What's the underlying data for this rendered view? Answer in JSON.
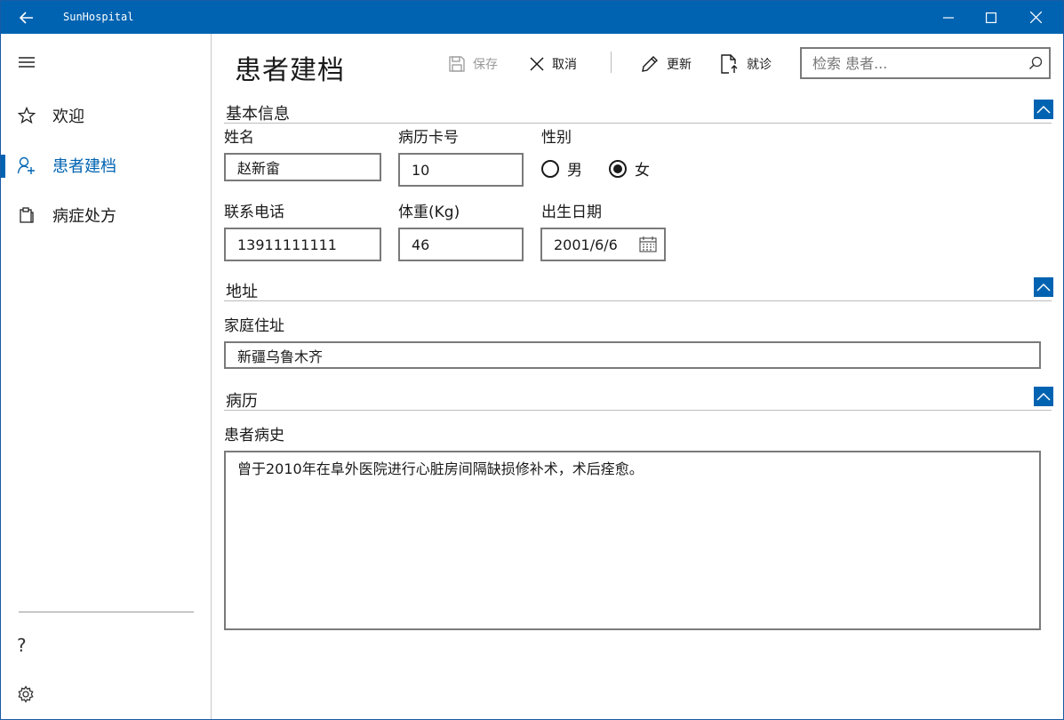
{
  "titlebar": {
    "app_title": "SunHospital",
    "back_icon": "arrow-left-icon",
    "minimize_icon": "minimize-icon",
    "maximize_icon": "maximize-icon",
    "close_icon": "close-icon",
    "background": "#0063b1"
  },
  "sidebar": {
    "menu_icon": "hamburger-icon",
    "items": [
      {
        "label": "欢迎",
        "icon": "star-icon",
        "active": false
      },
      {
        "label": "患者建档",
        "icon": "person-add-icon",
        "active": true
      },
      {
        "label": "病症处方",
        "icon": "clipboard-icon",
        "active": false
      }
    ],
    "help_glyph": "?",
    "settings_icon": "gear-icon",
    "accent": "#0063b1"
  },
  "page": {
    "title": "患者建档"
  },
  "toolbar": {
    "save_label": "保存",
    "cancel_label": "取消",
    "update_label": "更新",
    "visit_label": "就诊",
    "search_placeholder": "检索 患者..."
  },
  "basic_info": {
    "section_title": "基本信息",
    "name_label": "姓名",
    "name_value": "赵新畲",
    "card_label": "病历卡号",
    "card_value": "10",
    "gender_label": "性别",
    "gender_male": "男",
    "gender_female": "女",
    "gender_selected": "女",
    "phone_label": "联系电话",
    "phone_value": "13911111111",
    "weight_label": "体重(Kg)",
    "weight_value": "46",
    "birth_label": "出生日期",
    "birth_value": "2001/6/6"
  },
  "address": {
    "section_title": "地址",
    "home_label": "家庭住址",
    "home_value": "新疆乌鲁木齐"
  },
  "history": {
    "section_title": "病历",
    "history_label": "患者病史",
    "history_value": "曾于2010年在阜外医院进行心脏房间隔缺损修补术，术后痊愈。"
  }
}
